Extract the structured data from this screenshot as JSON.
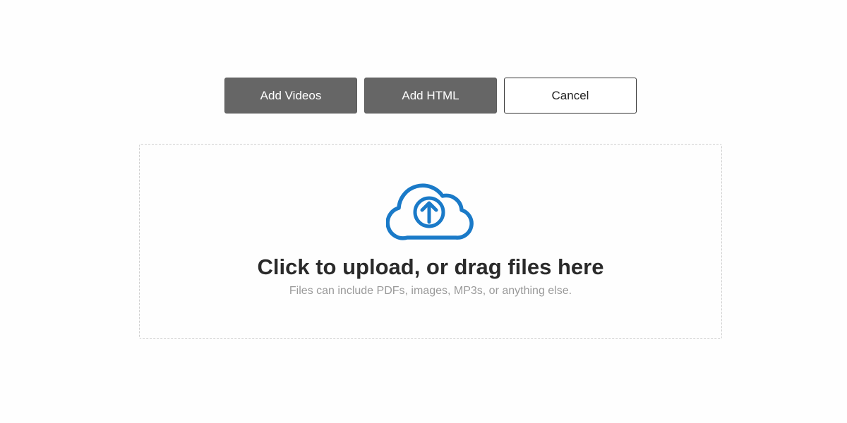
{
  "toolbar": {
    "add_videos_label": "Add Videos",
    "add_html_label": "Add HTML",
    "cancel_label": "Cancel"
  },
  "dropzone": {
    "title": "Click to upload, or drag files here",
    "subtitle": "Files can include PDFs, images, MP3s, or anything else.",
    "icon": "cloud-upload-icon"
  },
  "colors": {
    "icon_blue": "#1a7ac8",
    "button_dark": "#666666",
    "dashed_border": "#cfcfcf"
  }
}
